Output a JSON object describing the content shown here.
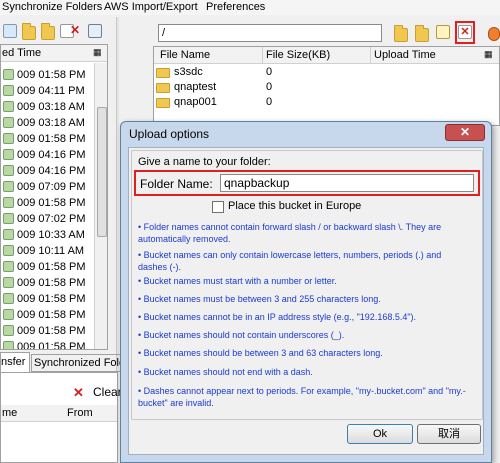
{
  "menu": {
    "items": [
      "Synchronize Folders",
      "AWS Import/Export",
      "Preferences"
    ]
  },
  "left_panel": {
    "header": "ed Time",
    "rows": [
      "009 01:58 PM",
      "009 04:11 PM",
      "009 03:18 AM",
      "009 03:18 AM",
      "009 01:58 PM",
      "009 04:16 PM",
      "009 04:16 PM",
      "009 07:09 PM",
      "009 01:58 PM",
      "009 07:02 PM",
      "009 10:33 AM",
      "009 10:11 AM",
      "009 01:58 PM",
      "009 01:58 PM",
      "009 01:58 PM",
      "009 01:58 PM",
      "009 01:58 PM",
      "009 01:58 PM",
      "009 01:58 PM"
    ]
  },
  "bottom_left": {
    "tab_transfer": "nsfer",
    "tab_synchronized": "Synchronized Fold",
    "clear_label": "Clear",
    "col_me": "me",
    "col_from": "From"
  },
  "right_panel": {
    "path": "/",
    "col_file_name": "File Name",
    "col_file_size": "File Size(KB)",
    "col_upload_time": "Upload Time",
    "rows": [
      {
        "name": "s3sdc",
        "size": "0"
      },
      {
        "name": "qnaptest",
        "size": "0"
      },
      {
        "name": "qnap001",
        "size": "0"
      }
    ]
  },
  "dialog": {
    "title": "Upload options",
    "close_label": "✕",
    "group_title": "Give a name to your folder:",
    "folder_label": "Folder Name:",
    "folder_value": "qnapbackup",
    "checkbox_label": "Place this bucket in Europe",
    "notes": [
      "• Folder names cannot contain forward slash / or backward slash \\. They are automatically removed.",
      "• Bucket names can only contain lowercase letters, numbers, periods (.) and dashes (-).",
      "• Bucket names must start with a number or letter.",
      "• Bucket names must be between 3 and 255 characters long.",
      "• Bucket names cannot be in an IP address style (e.g., \"192.168.5.4\").",
      "• Bucket names should not contain underscores (_).",
      "• Bucket names should be between 3 and 63 characters long.",
      "• Bucket names should not end with a dash.",
      "• Dashes cannot appear next to periods. For example, \"my-.bucket.com\" and \"my.-bucket\" are invalid."
    ],
    "ok_label": "Ok",
    "cancel_label": "取消"
  },
  "colors": {
    "highlight_red": "#e02020",
    "note_blue": "#1a3ad0",
    "dialog_frame": "#c8d8ec"
  }
}
